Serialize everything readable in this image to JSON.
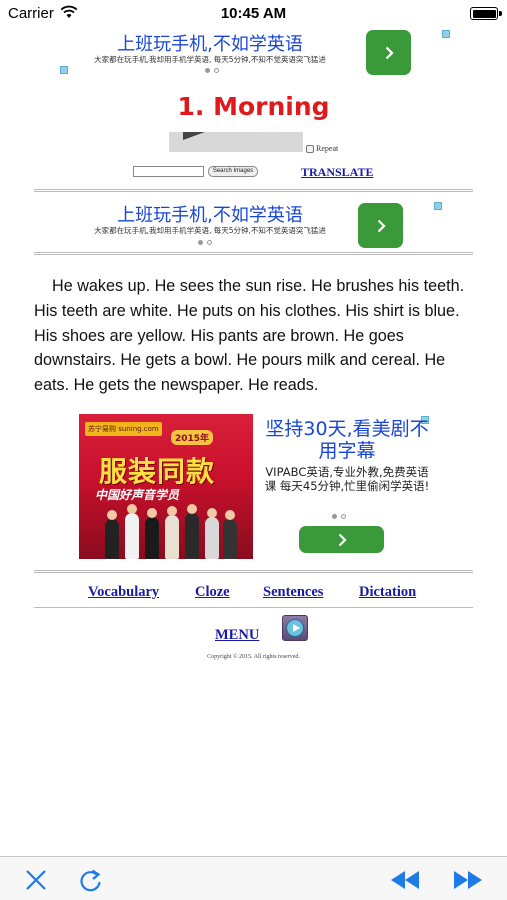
{
  "status_bar": {
    "carrier": "Carrier",
    "time": "10:45 AM",
    "icons": [
      "wifi-icon",
      "battery-icon"
    ]
  },
  "ad_top": {
    "title": "上班玩手机,不如学英语",
    "subtitle": "大家都在玩手机,我却用手机学英语, 每天5分钟,不知不觉英语突飞猛进",
    "button_icon": "chevron-right-icon",
    "accent": "#3a9a3a"
  },
  "lesson": {
    "title": "1. Morning",
    "title_color": "#e01a1a"
  },
  "player": {
    "repeat_label": "Repeat",
    "search_button_label": "Search Images",
    "translate_label": "TRANSLATE"
  },
  "ad_mid": {
    "title": "上班玩手机,不如学英语",
    "subtitle": "大家都在玩手机,我却用手机学英语, 每天5分钟,不知不觉英语突飞猛进",
    "button_icon": "chevron-right-icon"
  },
  "story": {
    "text": "He wakes up. He sees the sun rise. He brushes his teeth. His teeth are white. He puts on his clothes. His shirt is blue. His shoes are yellow. His pants are brown. He goes downstairs. He gets a bowl. He pours milk and cereal. He eats. He gets the newspaper. He reads."
  },
  "ad_big": {
    "image": {
      "brand": "苏宁易购 suning.com",
      "year": "2015年",
      "headline": "服装同款",
      "tagline": "中国好声音学员"
    },
    "title": "坚持30天,看美剧不用字幕",
    "description": "VIPABC英语,专业外教,免费英语课 每天45分钟,忙里偷闲学英语!",
    "button_icon": "chevron-right-icon"
  },
  "nav": {
    "vocabulary": "Vocabulary",
    "cloze": "Cloze",
    "sentences": "Sentences",
    "dictation": "Dictation",
    "menu": "MENU"
  },
  "footer": {
    "copyright": "Copyright © 2015. All rights reserved."
  },
  "toolbar": {
    "close_icon": "close-icon",
    "reload_icon": "reload-icon",
    "rewind_icon": "rewind-icon",
    "fast_forward_icon": "fast-forward-icon",
    "tint": "#1e7be6"
  }
}
